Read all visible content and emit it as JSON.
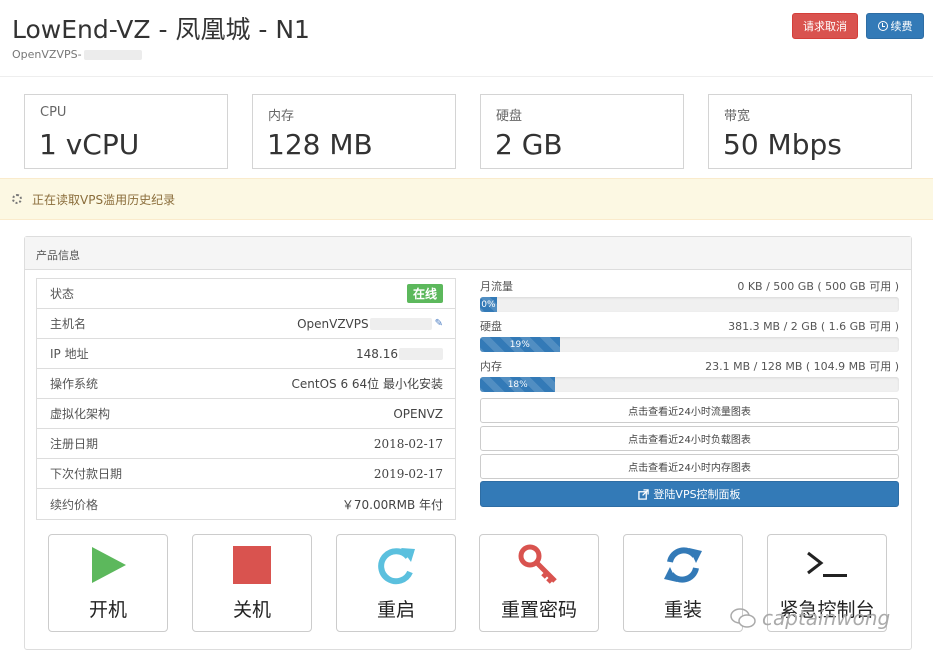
{
  "header": {
    "title": "LowEnd-VZ - 凤凰城 - N1",
    "subtitle": "OpenVZVPS-",
    "cancel_label": "请求取消",
    "renew_label": "续费"
  },
  "stats": [
    {
      "label": "CPU",
      "value": "1 vCPU"
    },
    {
      "label": "内存",
      "value": "128 MB"
    },
    {
      "label": "硬盘",
      "value": "2 GB"
    },
    {
      "label": "带宽",
      "value": "50 Mbps"
    }
  ],
  "alert": {
    "text": "正在读取VPS滥用历史纪录"
  },
  "panel": {
    "title": "产品信息"
  },
  "info": [
    {
      "key": "状态",
      "value": "在线"
    },
    {
      "key": "主机名",
      "value": "OpenVZVPS"
    },
    {
      "key": "IP 地址",
      "value": "148.16"
    },
    {
      "key": "操作系统",
      "value": "CentOS 6 64位 最小化安装"
    },
    {
      "key": "虚拟化架构",
      "value": "OPENVZ"
    },
    {
      "key": "注册日期",
      "value": "2018-02-17"
    },
    {
      "key": "下次付款日期",
      "value": "2019-02-17"
    },
    {
      "key": "续约价格",
      "value": "￥70.00RMB 年付"
    }
  ],
  "usage": [
    {
      "label": "月流量",
      "detail": "0 KB / 500 GB ( 500 GB 可用 )",
      "percent": 0,
      "percent_label": "0%"
    },
    {
      "label": "硬盘",
      "detail": "381.3 MB / 2 GB ( 1.6 GB 可用 )",
      "percent": 19,
      "percent_label": "19%"
    },
    {
      "label": "内存",
      "detail": "23.1 MB / 128 MB ( 104.9 MB 可用 )",
      "percent": 18,
      "percent_label": "18%"
    }
  ],
  "chart_links": {
    "traffic": "点击查看近24小时流量图表",
    "load": "点击查看近24小时负载图表",
    "memory": "点击查看近24小时内存图表"
  },
  "login_label": "登陆VPS控制面板",
  "actions": {
    "start": "开机",
    "stop": "关机",
    "restart": "重启",
    "reset_password": "重置密码",
    "reinstall": "重装",
    "console": "紧急控制台"
  },
  "watermark": "captainwong",
  "colors": {
    "primary": "#337ab7",
    "danger": "#d9534f",
    "success": "#5cb85c",
    "warning_bg": "#fcf8e3"
  }
}
